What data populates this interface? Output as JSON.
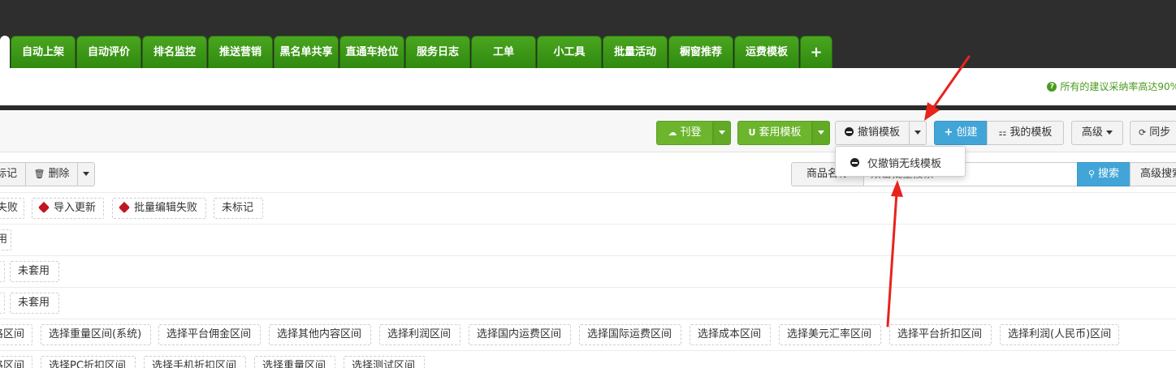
{
  "tabs": [
    "",
    "自动上架",
    "自动评价",
    "排名监控",
    "推送营销",
    "黑名单共享",
    "直通车抢位",
    "服务日志",
    "工单",
    "小工具",
    "批量活动",
    "橱窗推荐",
    "运费模板"
  ],
  "tip": {
    "text": "所有的建议采纳率高达90%"
  },
  "toolbar": {
    "publish": "刊登",
    "apply_template": "套用模板",
    "revoke_template": "撤销模板",
    "create": "创建",
    "my_templates": "我的模板",
    "advanced": "高级",
    "sync": "同步"
  },
  "dropdown": {
    "item": "仅撤销无线模板"
  },
  "filterbar": {
    "mark": "标记",
    "delete": "删除",
    "field_select": "商品名称",
    "search_placeholder": "双击批量搜索",
    "search_btn": "搜索",
    "advanced_search": "高级搜索"
  },
  "rows": {
    "r1": [
      "失败",
      "导入更新",
      "批量编辑失败",
      "未标记"
    ],
    "r2": [
      "用"
    ],
    "r3": [
      "",
      "未套用"
    ],
    "r4": [
      "",
      "未套用"
    ],
    "r5": [
      "格区间",
      "选择重量区间(系统)",
      "选择平台佣金区间",
      "选择其他内容区间",
      "选择利润区间",
      "选择国内运费区间",
      "选择国际运费区间",
      "选择成本区间",
      "选择美元汇率区间",
      "选择平台折扣区间",
      "选择利润(人民币)区间"
    ],
    "r6": [
      "格区间",
      "选择PC折扣区间",
      "选择手机折扣区间",
      "选择重量区间",
      "选择测试区间"
    ]
  },
  "colors": {
    "tab_green": "#3a9a15",
    "accent_green": "#6cb52d",
    "accent_blue": "#42a5d8",
    "arrow_red": "#e8231c",
    "tag_red": "#c0161f"
  }
}
